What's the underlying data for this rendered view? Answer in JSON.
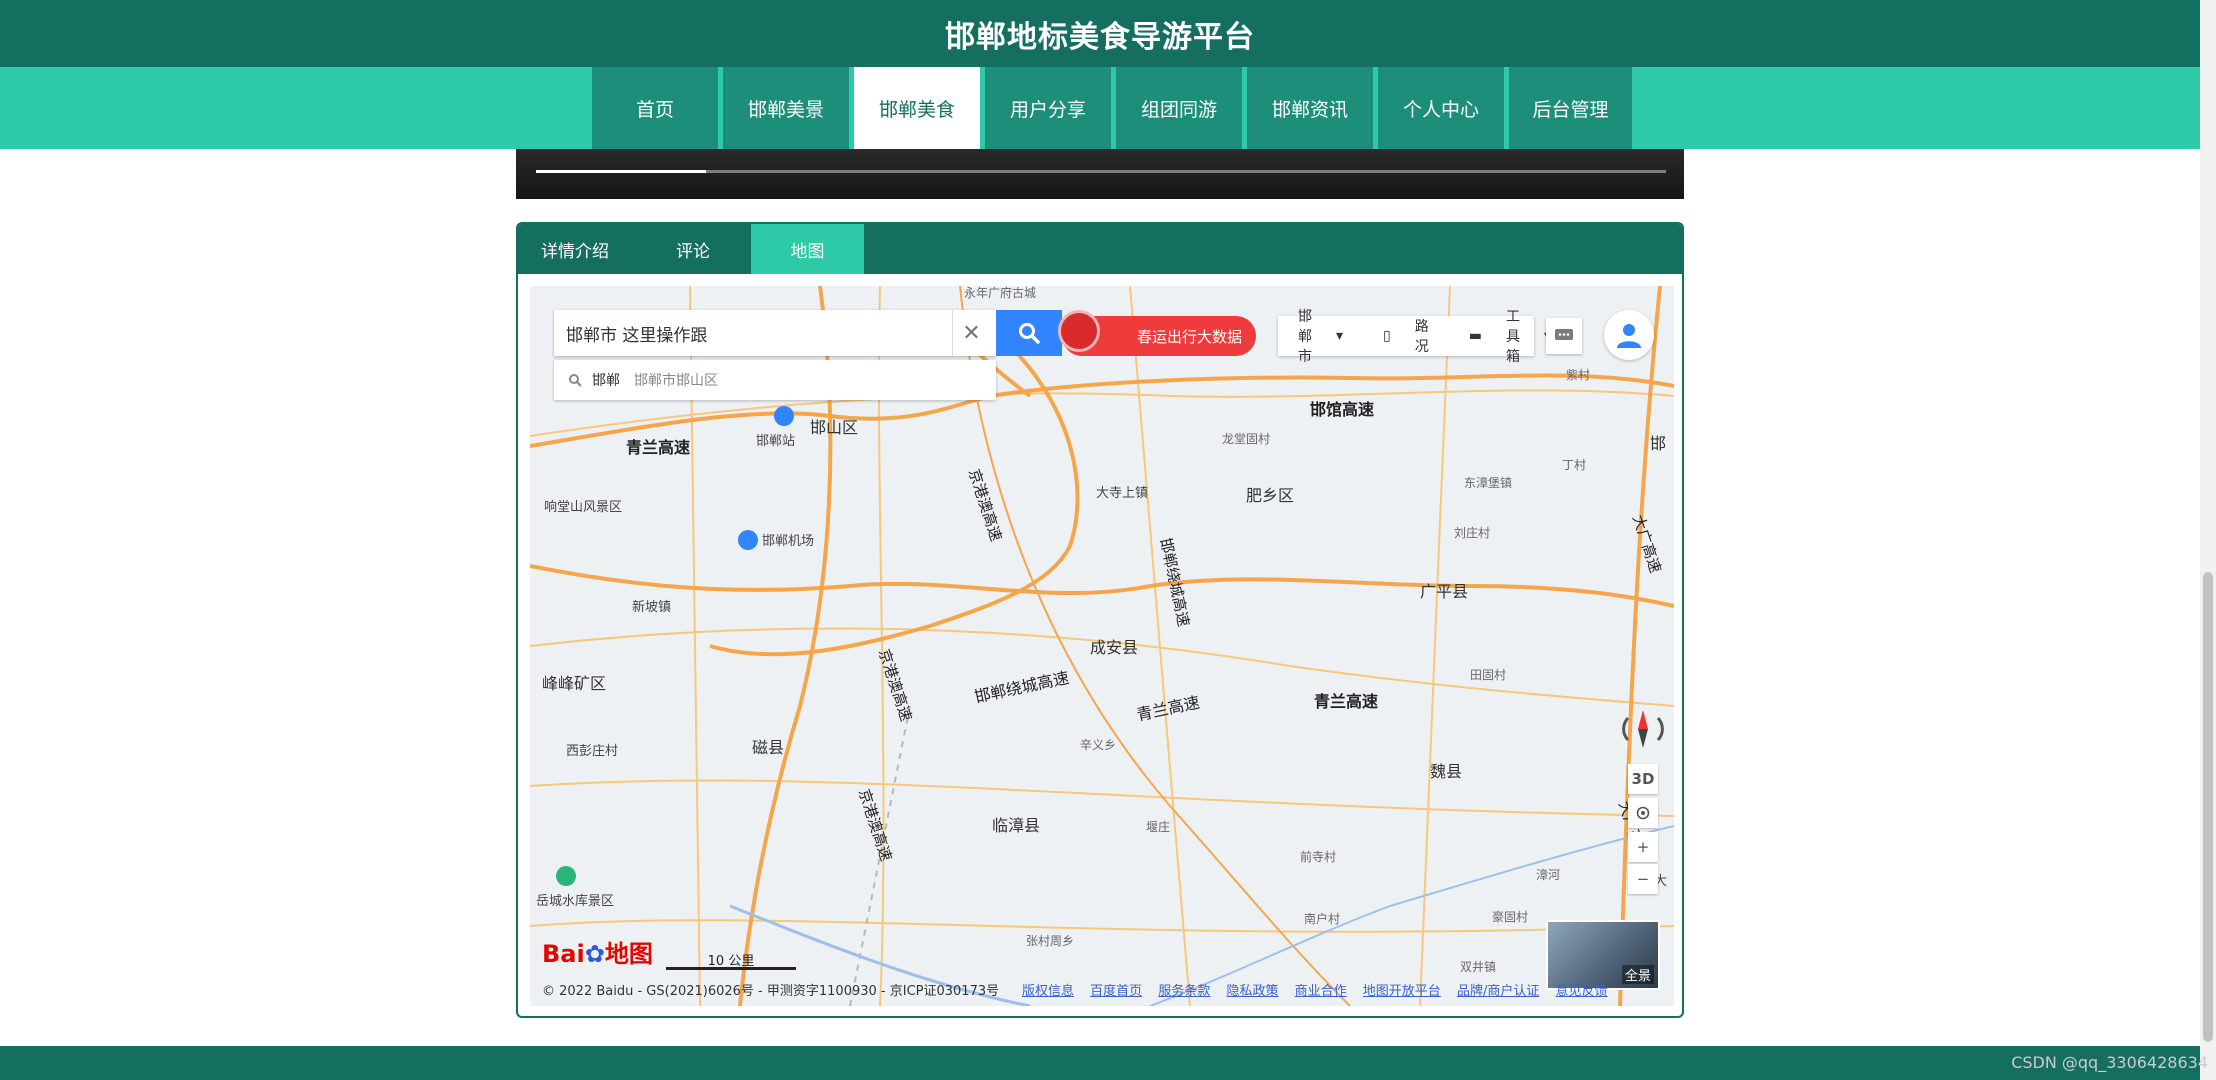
{
  "site": {
    "title": "邯郸地标美食导游平台"
  },
  "nav": {
    "items": [
      "首页",
      "邯郸美景",
      "邯郸美食",
      "用户分享",
      "组团同游",
      "邯郸资讯",
      "个人中心",
      "后台管理"
    ],
    "active_index": 2
  },
  "slider": {
    "progress_percent": 15
  },
  "detail_tabs": {
    "items": [
      "详情介绍",
      "评论",
      "地图"
    ],
    "active": "地图"
  },
  "map": {
    "search": {
      "value": "邯郸市 这里操作跟"
    },
    "suggestion": {
      "city": "邯郸",
      "area": "邯郸市邯山区"
    },
    "promo_label": "春运出行大数据",
    "controls": {
      "city": "邯郸市",
      "traffic": "路况",
      "toolbox": "工具箱"
    },
    "layer_3d": "3D",
    "zoom_in": "+",
    "zoom_out": "−",
    "panorama_label": "全景",
    "scale_label": "10 公里",
    "logo_text": "地图",
    "copyright": "© 2022 Baidu - GS(2021)6026号 - 甲测资字1100930 - 京ICP证030173号",
    "footer_links": [
      "版权信息",
      "百度首页",
      "服务条款",
      "隐私政策",
      "商业合作",
      "地图开放平台",
      "品牌/商户认证",
      "意见反馈"
    ],
    "places": {
      "yongnian": "永年广府古城",
      "handan_station": "邯郸站",
      "hanshan": "邯山区",
      "handan_airport": "邯郸机场",
      "xiangtang": "响堂山风景区",
      "xinpo": "新坡镇",
      "fengfeng": "峰峰矿区",
      "xidu": "西彭庄村",
      "ci": "磁县",
      "yuecheng": "岳城水库景区",
      "feixiang": "肥乡区",
      "guangping": "广平县",
      "chengan": "成安县",
      "linzhang": "临漳县",
      "wei": "魏县",
      "dasi": "大寺上镇",
      "longwang": "龙堂固村",
      "dongyang": "东漳堡镇",
      "liuzhuang": "刘庄村",
      "dingcun": "丁村",
      "tiangucun": "田固村",
      "xinyi": "辛义乡",
      "zhangzhuang": "张村周乡",
      "nanhu": "南户村",
      "shuangjing": "双井镇",
      "handan_right": "邯",
      "da_right": "大",
      "ziyi": "紫村",
      "zhengting": "堰庄",
      "he": "河",
      "qiancun": "前寺村",
      "gouxian": "豪固村"
    },
    "highways": {
      "qinglan_left": "青兰高速",
      "qinglan_mid": "青兰高速",
      "qinglan_right": "青兰高速",
      "handan_guan": "邯馆高速",
      "jinggangao_1": "京港澳高速",
      "jinggangao_2": "京港澳高速",
      "jinggangao_3": "京港澳高速",
      "handan_ring_1": "邯郸绕城高速",
      "handan_ring_2": "邯郸绕城高速",
      "daguang_1": "大广高速",
      "daguang_2": "大广高速",
      "zhanghe": "漳河"
    }
  },
  "watermark": "CSDN @qq_3306428634",
  "colors": {
    "header": "#146f61",
    "nav": "#2ec9a7",
    "search_button": "#3385ff",
    "promo": "#ef3b3b"
  }
}
